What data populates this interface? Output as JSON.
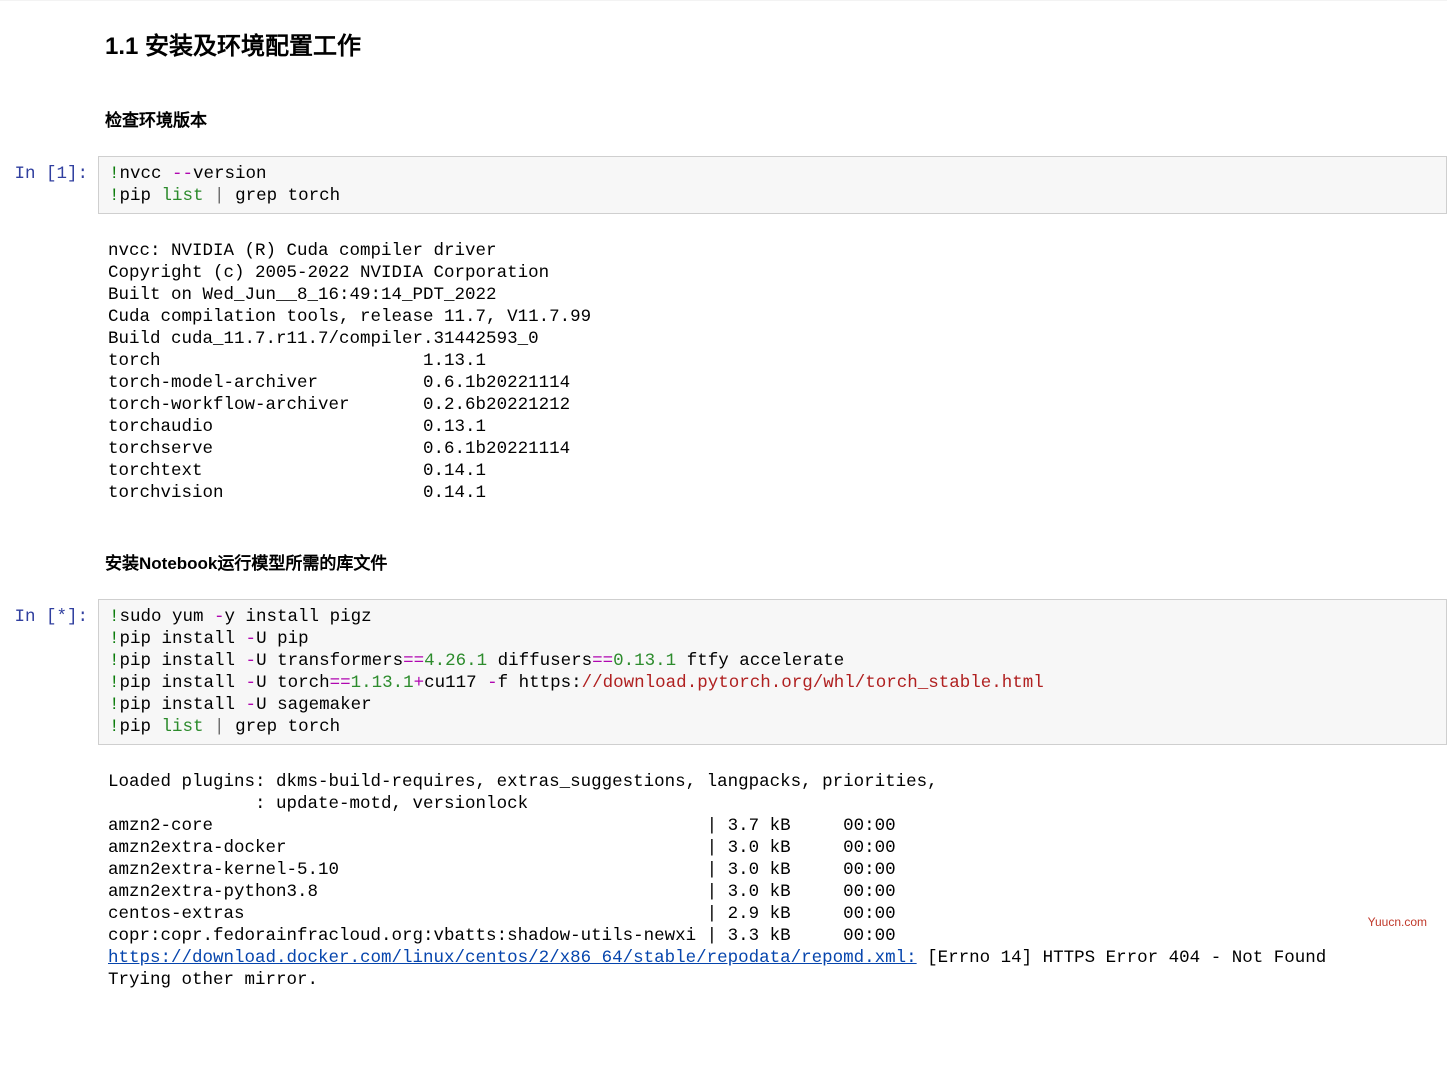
{
  "section": {
    "number": "1.1",
    "title_zh": "安装及环境配置工作",
    "subheading_1": "检查环境版本",
    "subheading_2": "安装Notebook运行模型所需的库文件"
  },
  "cell1": {
    "prompt": "In [1]:",
    "code": {
      "line1": {
        "bang": "!",
        "cmd": "nvcc ",
        "flag": "--",
        "rest": "version"
      },
      "line2": {
        "bang": "!",
        "cmd": "pip ",
        "builtin": "list",
        "pipe": " | ",
        "rest": "grep torch"
      }
    },
    "output_lines": [
      "nvcc: NVIDIA (R) Cuda compiler driver",
      "Copyright (c) 2005-2022 NVIDIA Corporation",
      "Built on Wed_Jun__8_16:49:14_PDT_2022",
      "Cuda compilation tools, release 11.7, V11.7.99",
      "Build cuda_11.7.r11.7/compiler.31442593_0",
      "torch                         1.13.1",
      "torch-model-archiver          0.6.1b20221114",
      "torch-workflow-archiver       0.2.6b20221212",
      "torchaudio                    0.13.1",
      "torchserve                    0.6.1b20221114",
      "torchtext                     0.14.1",
      "torchvision                   0.14.1"
    ]
  },
  "cell2": {
    "prompt": "In [*]:",
    "code": {
      "l1": {
        "bang": "!",
        "a": "sudo yum ",
        "flag1": "-",
        "b": "y install pigz"
      },
      "l2": {
        "bang": "!",
        "a": "pip install ",
        "flag1": "-",
        "b": "U pip"
      },
      "l3": {
        "bang": "!",
        "a": "pip install ",
        "flag1": "-",
        "b": "U transformers",
        "eq1": "==",
        "v1": "4.26.1",
        "c": " diffusers",
        "eq2": "==",
        "v2": "0.13.1",
        "d": " ftfy accelerate"
      },
      "l4": {
        "bang": "!",
        "a": "pip install ",
        "flag1": "-",
        "b": "U torch",
        "eq1": "==",
        "v1": "1.13.1",
        "plus": "+",
        "c": "cu117 ",
        "flag2": "-",
        "d": "f https:",
        "url": "//download.pytorch.org/whl/torch_stable.html"
      },
      "l5": {
        "bang": "!",
        "a": "pip install ",
        "flag1": "-",
        "b": "U sagemaker"
      },
      "l6": {
        "bang": "!",
        "a": "pip ",
        "builtin": "list",
        "pipe": " | ",
        "b": "grep torch"
      }
    },
    "output_lines_top": [
      "Loaded plugins: dkms-build-requires, extras_suggestions, langpacks, priorities,",
      "              : update-motd, versionlock",
      "amzn2-core                                               | 3.7 kB     00:00",
      "amzn2extra-docker                                        | 3.0 kB     00:00",
      "amzn2extra-kernel-5.10                                   | 3.0 kB     00:00",
      "amzn2extra-python3.8                                     | 3.0 kB     00:00",
      "centos-extras                                            | 2.9 kB     00:00",
      "copr:copr.fedorainfracloud.org:vbatts:shadow-utils-newxi | 3.3 kB     00:00"
    ],
    "output_url": "https://download.docker.com/linux/centos/2/x86_64/stable/repodata/repomd.xml:",
    "output_err": " [Errno 14] HTTPS Error 404 - Not Found",
    "output_tail": "Trying other mirror."
  },
  "watermark": "Yuucn.com"
}
